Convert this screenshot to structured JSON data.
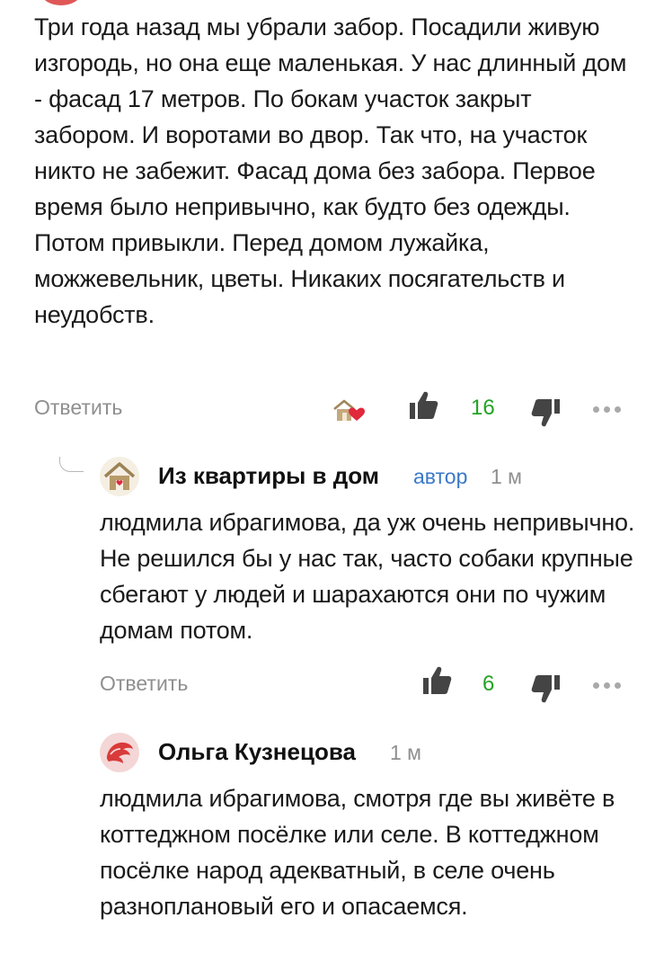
{
  "colors": {
    "text": "#1a1a1a",
    "muted": "#8f8f8f",
    "likes": "#23a323",
    "author_badge": "#3a78c9",
    "brand_red": "#d93a3a"
  },
  "comments": [
    {
      "text": "Три года назад мы убрали забор. Посадили живую изгородь, но она еще маленькая. У нас длинный дом - фасад 17 метров. По бокам участок закрыт забором. И воротами во двор. Так что, на участок никто не забежит. Фасад дома без забора. Первое время было непривычно, как будто без одежды. Потом привыкли. Перед домом лужайка, можжевельник, цветы. Никаких посягательств и неудобств.",
      "reply_label": "Ответить",
      "likes": "16",
      "icons": [
        "author-heart-house-icon",
        "thumbs-up-icon",
        "thumbs-down-icon",
        "more-icon"
      ]
    },
    {
      "author": "Из квартиры в дом",
      "badge": "автор",
      "time": "1 м",
      "avatar_icon": "house-logo-icon",
      "text": "людмила ибрагимова, да уж очень непривычно. Не решился бы у нас так, часто собаки крупные сбегают у людей и шарахаются они по чужим домам потом.",
      "reply_label": "Ответить",
      "likes": "6",
      "icons": [
        "thumbs-up-icon",
        "thumbs-down-icon",
        "more-icon"
      ]
    },
    {
      "author": "Ольга Кузнецова",
      "time": "1 м",
      "avatar_icon": "red-avatar-icon",
      "text": "людмила ибрагимова, смотря где вы живёте в коттеджном посёлке или селе. В коттеджном посёлке народ адекватный, в селе очень разноплановый его и опасаемся."
    }
  ]
}
